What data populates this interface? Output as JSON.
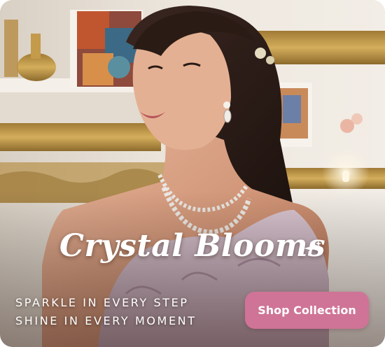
{
  "banner": {
    "headline": "Crystal Blooms",
    "tagline_line1": "SPARKLE IN EVERY STEP",
    "tagline_line2": "SHINE IN EVERY MOMENT",
    "cta_label": "Shop Collection",
    "image_alt": "Model wearing crystal necklace and earrings"
  },
  "colors": {
    "cta_background": "#cf7496",
    "text": "#ffffff"
  },
  "icons": {
    "sparkle": "sparkle-icon"
  }
}
